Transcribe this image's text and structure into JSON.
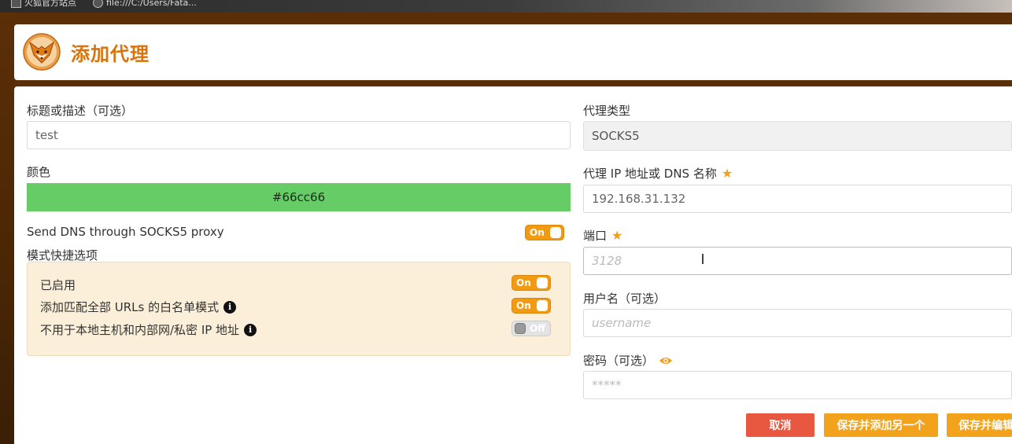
{
  "browser": {
    "bookmark1": "火狐官方站点",
    "bookmark2": "file:///C:/Users/Fata..."
  },
  "header": {
    "title": "添加代理",
    "logo_icon": "foxyproxy-fox-logo"
  },
  "form": {
    "title_label": "标题或描述（可选）",
    "title_value": "test",
    "color_label": "颜色",
    "color_value": "#66cc66",
    "dns_label": "Send DNS through SOCKS5 proxy",
    "dns_toggle": "On",
    "pattern_label": "模式快捷选项",
    "patterns": [
      {
        "label": "已启用",
        "toggle": "On",
        "info": false
      },
      {
        "label": "添加匹配全部 URLs 的白名单模式",
        "toggle": "On",
        "info": true
      },
      {
        "label": "不用于本地主机和内部网/私密 IP 地址",
        "toggle": "Off",
        "info": true
      }
    ],
    "proxy_type_label": "代理类型",
    "proxy_type_value": "SOCKS5",
    "host_label": "代理 IP 地址或 DNS 名称",
    "host_value": "192.168.31.132",
    "port_label": "端口",
    "port_placeholder": "3128",
    "username_label": "用户名（可选）",
    "username_placeholder": "username",
    "password_label": "密码（可选）",
    "password_placeholder": "*****"
  },
  "buttons": {
    "cancel": "取消",
    "save_add_another": "保存并添加另一个",
    "save_edit": "保存并编辑"
  },
  "colors": {
    "accent": "#f29b12",
    "title": "#d9730a",
    "cancel": "#e8573f",
    "swatch": "#66cc66",
    "pattern_box": "#fbefda"
  }
}
